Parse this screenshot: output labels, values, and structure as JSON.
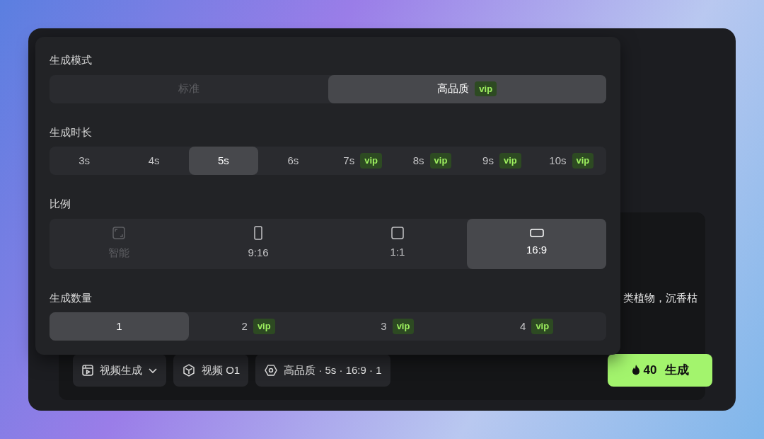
{
  "prompt_text": "类植物，沉香枯",
  "settings": [
    {
      "title": "生成模式",
      "options": [
        {
          "label": "标准",
          "selected": false,
          "disabled": true
        },
        {
          "label": "高品质",
          "badge": "vip",
          "selected": true,
          "disabled": false
        }
      ]
    },
    {
      "title": "生成时长",
      "options": [
        {
          "label": "3s",
          "selected": false,
          "disabled": false
        },
        {
          "label": "4s",
          "selected": false,
          "disabled": false
        },
        {
          "label": "5s",
          "selected": true,
          "disabled": false
        },
        {
          "label": "6s",
          "selected": false,
          "disabled": false
        },
        {
          "label": "7s",
          "badge": "vip",
          "selected": false,
          "disabled": false
        },
        {
          "label": "8s",
          "badge": "vip",
          "selected": false,
          "disabled": false
        },
        {
          "label": "9s",
          "badge": "vip",
          "selected": false,
          "disabled": false
        },
        {
          "label": "10s",
          "badge": "vip",
          "selected": false,
          "disabled": false
        }
      ]
    },
    {
      "title": "比例",
      "options": [
        {
          "label": "智能",
          "kind": "auto",
          "selected": false,
          "disabled": true
        },
        {
          "label": "9:16",
          "kind": "portrait",
          "selected": false,
          "disabled": false
        },
        {
          "label": "1:1",
          "kind": "square",
          "selected": false,
          "disabled": false
        },
        {
          "label": "16:9",
          "kind": "landscape",
          "selected": true,
          "disabled": false
        }
      ]
    },
    {
      "title": "生成数量",
      "options": [
        {
          "label": "1",
          "selected": true,
          "disabled": false
        },
        {
          "label": "2",
          "badge": "vip",
          "selected": false,
          "disabled": false
        },
        {
          "label": "3",
          "badge": "vip",
          "selected": false,
          "disabled": false
        },
        {
          "label": "4",
          "badge": "vip",
          "selected": false,
          "disabled": false
        }
      ]
    }
  ],
  "toolbar": [
    {
      "kind": "mode",
      "label": "视频生成"
    },
    {
      "kind": "model",
      "label": "视频 O1"
    },
    {
      "kind": "settings",
      "label": "高品质 · 5s · 16:9 · 1"
    }
  ],
  "generate": {
    "cost": "40",
    "label": "生成"
  }
}
